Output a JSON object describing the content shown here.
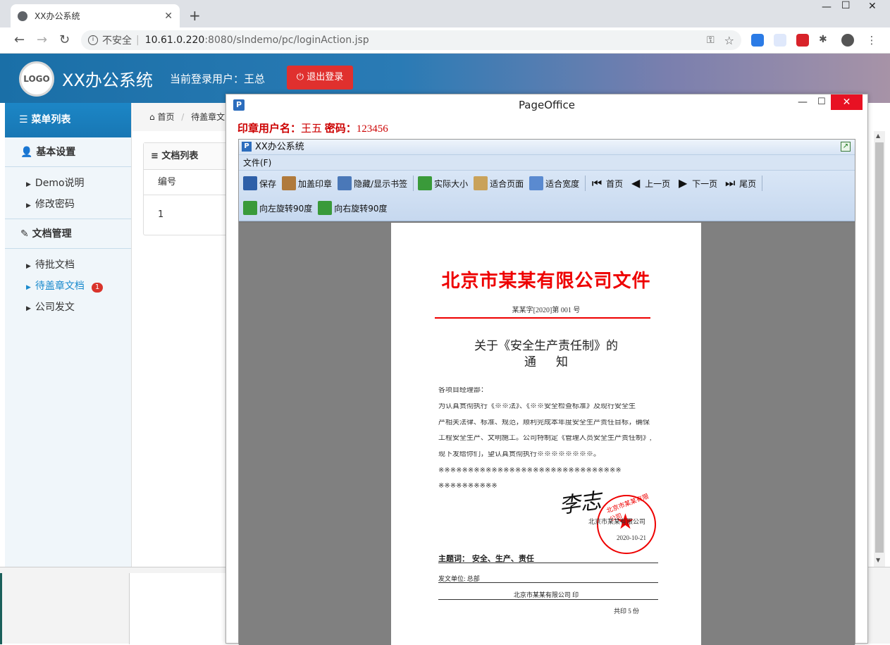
{
  "browser": {
    "tab_title": "XX办公系统",
    "new_tab_label": "+",
    "url_insecure_label": "不安全",
    "url_host": "10.61.0.220",
    "url_path": ":8080/slndemo/pc/loginAction.jsp"
  },
  "header": {
    "logo_text": "LOGO",
    "app_title": "XX办公系统",
    "current_user": "当前登录用户：王总",
    "logout_label": "退出登录"
  },
  "sidebar": {
    "menu_title": "菜单列表",
    "groups": [
      {
        "label": "基本设置",
        "items": [
          {
            "label": "Demo说明"
          },
          {
            "label": "修改密码"
          }
        ]
      },
      {
        "label": "文档管理",
        "items": [
          {
            "label": "待批文档"
          },
          {
            "label": "待盖章文档",
            "badge": "1",
            "active": true
          },
          {
            "label": "公司发文"
          }
        ]
      }
    ]
  },
  "main": {
    "breadcrumb_home": "首页",
    "breadcrumb_current": "待盖章文",
    "panel_title": "文档列表",
    "column_number": "编号",
    "row_value": "1"
  },
  "pageoffice": {
    "window_title": "PageOffice",
    "user_label": "印章用户名：",
    "user_name": "王五",
    "password_label": " 密码：",
    "password_value": "123456",
    "office_title": "XX办公系统",
    "menu_file": "文件(F)",
    "toolbar_row1": [
      {
        "label": "保存",
        "icon": "save-icon",
        "color": "#2d5fa8"
      },
      {
        "label": "加盖印章",
        "icon": "stamp-icon",
        "color": "#b07a3c"
      },
      {
        "label": "隐藏/显示书签",
        "icon": "bookmark-icon",
        "color": "#4a78b8"
      },
      {
        "label": "实际大小",
        "icon": "actual-size-icon",
        "color": "#3a9a3a"
      },
      {
        "label": "适合页面",
        "icon": "fit-page-icon",
        "color": "#c9a25a"
      },
      {
        "label": "适合宽度",
        "icon": "fit-width-icon",
        "color": "#5a8ad0"
      },
      {
        "label": "首页",
        "icon": "first-page-icon",
        "color": "#111111"
      },
      {
        "label": "上一页",
        "icon": "prev-page-icon",
        "color": "#111111"
      },
      {
        "label": "下一页",
        "icon": "next-page-icon",
        "color": "#111111"
      },
      {
        "label": "尾页",
        "icon": "last-page-icon",
        "color": "#111111"
      }
    ],
    "toolbar_row2": [
      {
        "label": "向左旋转90度",
        "icon": "rotate-left-icon",
        "color": "#3a9a3a"
      },
      {
        "label": "向右旋转90度",
        "icon": "rotate-right-icon",
        "color": "#3a9a3a"
      }
    ]
  },
  "document": {
    "heading": "北京市某某有限公司文件",
    "number": "某某字[2020]第 001 号",
    "subject_line1": "关于《安全生产责任制》的",
    "subject_line2": "通知",
    "body_lines": [
      "各项目经理部：",
      "      为认真贯彻执行《※※法》、《※※安全检查标准》及现行安全生",
      "产相关法律、标准、规范，顺利完成本年度安全生产责任目标，确保",
      "工程安全生产、文明施工。公司特制定《管理人员安全生产责任制》,",
      "现下发给你们，望认真贯彻执行※※※※※※※※。",
      "      ※※※※※※※※※※※※※※※※※※※※※※※※※※※※※※※",
      "※※※※※※※※※※"
    ],
    "signature": "李志",
    "seal_arc_text": "北京市某某有限公司",
    "seal_company": "北京市某某有限公司",
    "seal_date": "2020-10-21",
    "keywords": "主题词：  安全、生产、责任",
    "issuer": "发文单位:   总部",
    "printer": "北京市某某有限公司    印",
    "copies": "共印 5 份"
  },
  "colors": {
    "accent": "#1a8acd",
    "logout": "#e0302e",
    "red_heading": "#e00000",
    "badge": "#d9342b"
  }
}
